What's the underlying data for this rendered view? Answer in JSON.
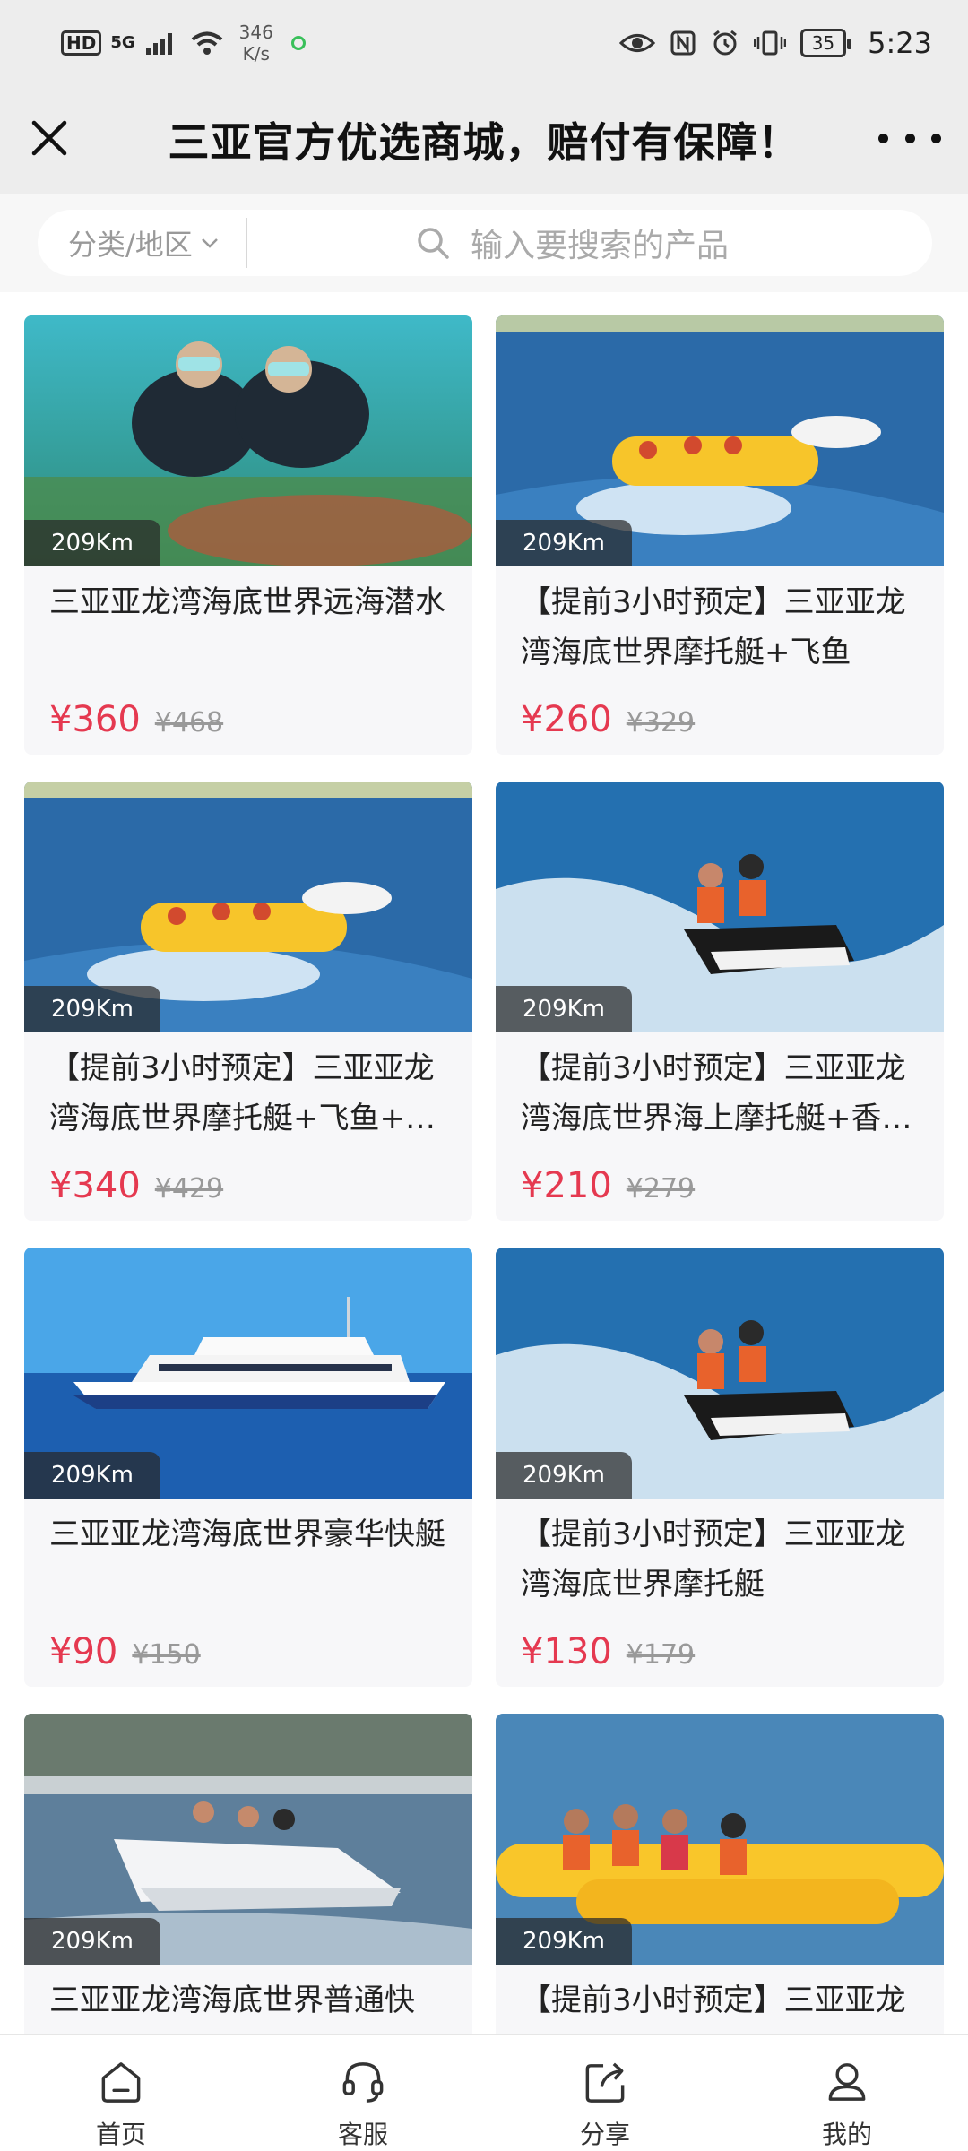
{
  "status_bar": {
    "hd": "HD",
    "network": "5G",
    "speed_value": "346",
    "speed_unit": "K/s",
    "battery": "35",
    "time": "5:23"
  },
  "header": {
    "title": "三亚官方优选商城，赔付有保障！"
  },
  "search": {
    "category_label": "分类/地区",
    "placeholder": "输入要搜索的产品"
  },
  "products": [
    {
      "title": "三亚亚龙湾海底世界远海潜水",
      "price": "¥360",
      "old_price": "¥468",
      "distance": "209Km"
    },
    {
      "title": "【提前3小时预定】三亚亚龙湾海底世界摩托艇+飞鱼",
      "price": "¥260",
      "old_price": "¥329",
      "distance": "209Km"
    },
    {
      "title": "【提前3小时预定】三亚亚龙湾海底世界摩托艇+飞鱼+…",
      "price": "¥340",
      "old_price": "¥429",
      "distance": "209Km"
    },
    {
      "title": "【提前3小时预定】三亚亚龙湾海底世界海上摩托艇+香…",
      "price": "¥210",
      "old_price": "¥279",
      "distance": "209Km"
    },
    {
      "title": "三亚亚龙湾海底世界豪华快艇",
      "price": "¥90",
      "old_price": "¥150",
      "distance": "209Km"
    },
    {
      "title": "【提前3小时预定】三亚亚龙湾海底世界摩托艇",
      "price": "¥130",
      "old_price": "¥179",
      "distance": "209Km"
    },
    {
      "title": "三亚亚龙湾海底世界普通快",
      "price": "",
      "old_price": "",
      "distance": "209Km"
    },
    {
      "title": "【提前3小时预定】三亚亚龙",
      "price": "",
      "old_price": "",
      "distance": "209Km"
    }
  ],
  "nav": {
    "home": "首页",
    "service": "客服",
    "share": "分享",
    "mine": "我的"
  },
  "colors": {
    "price": "#e53950",
    "background": "#ededed"
  }
}
